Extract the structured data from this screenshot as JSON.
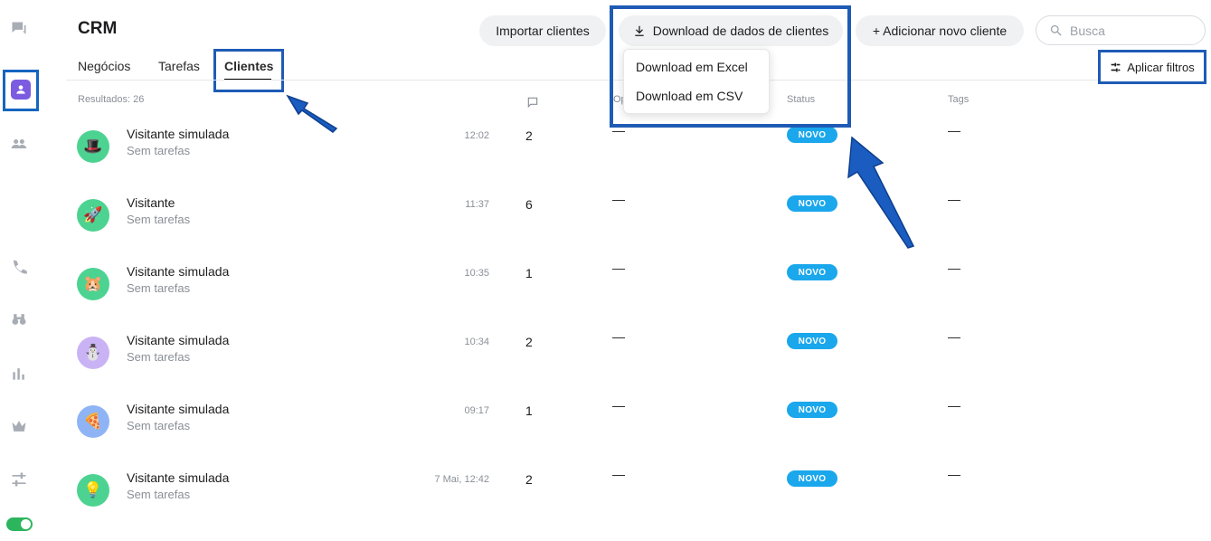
{
  "app": {
    "title": "CRM"
  },
  "header": {
    "import_label": "Importar clientes",
    "download_label": "Download de dados de clientes",
    "add_label": "+ Adicionar novo cliente",
    "search_placeholder": "Busca"
  },
  "download_menu": {
    "items": [
      "Download em Excel",
      "Download em CSV"
    ]
  },
  "tabs": [
    {
      "label": "Negócios"
    },
    {
      "label": "Tarefas"
    },
    {
      "label": "Clientes",
      "active": true
    }
  ],
  "filters_label": "Aplicar filtros",
  "table": {
    "results_label": "Resultados: 26",
    "columns": {
      "op": "Op",
      "status": "Status",
      "tags": "Tags"
    },
    "rows": [
      {
        "name": "Visitante simulada",
        "tasks": "Sem tarefas",
        "time": "12:02",
        "count": "2",
        "op": "—",
        "status": "NOVO",
        "tags": "—",
        "avatar_icon": "🎩",
        "avatar_color": "#4cd391"
      },
      {
        "name": "Visitante",
        "tasks": "Sem tarefas",
        "time": "11:37",
        "count": "6",
        "op": "—",
        "status": "NOVO",
        "tags": "—",
        "avatar_icon": "🚀",
        "avatar_color": "#4cd391"
      },
      {
        "name": "Visitante simulada",
        "tasks": "Sem tarefas",
        "time": "10:35",
        "count": "1",
        "op": "—",
        "status": "NOVO",
        "tags": "—",
        "avatar_icon": "🐹",
        "avatar_color": "#4cd391"
      },
      {
        "name": "Visitante simulada",
        "tasks": "Sem tarefas",
        "time": "10:34",
        "count": "2",
        "op": "—",
        "status": "NOVO",
        "tags": "—",
        "avatar_icon": "⛄",
        "avatar_color": "#c9b3f5"
      },
      {
        "name": "Visitante simulada",
        "tasks": "Sem tarefas",
        "time": "09:17",
        "count": "1",
        "op": "—",
        "status": "NOVO",
        "tags": "—",
        "avatar_icon": "🍕",
        "avatar_color": "#8fb4f5"
      },
      {
        "name": "Visitante simulada",
        "tasks": "Sem tarefas",
        "time": "7 Mai, 12:42",
        "count": "2",
        "op": "—",
        "status": "NOVO",
        "tags": "—",
        "avatar_icon": "💡",
        "avatar_color": "#4cd391"
      }
    ]
  },
  "sidebar": {
    "icons": [
      "chat-icon",
      "crm-icon",
      "team-icon",
      "phone-icon",
      "binoculars-icon",
      "stats-icon",
      "crown-icon",
      "settings-icon"
    ],
    "toggle_on": true
  },
  "colors": {
    "accent": "#7b5ce0",
    "badge": "#1aa7ec",
    "highlight": "#1e5bb5",
    "toggle": "#2db55d"
  }
}
